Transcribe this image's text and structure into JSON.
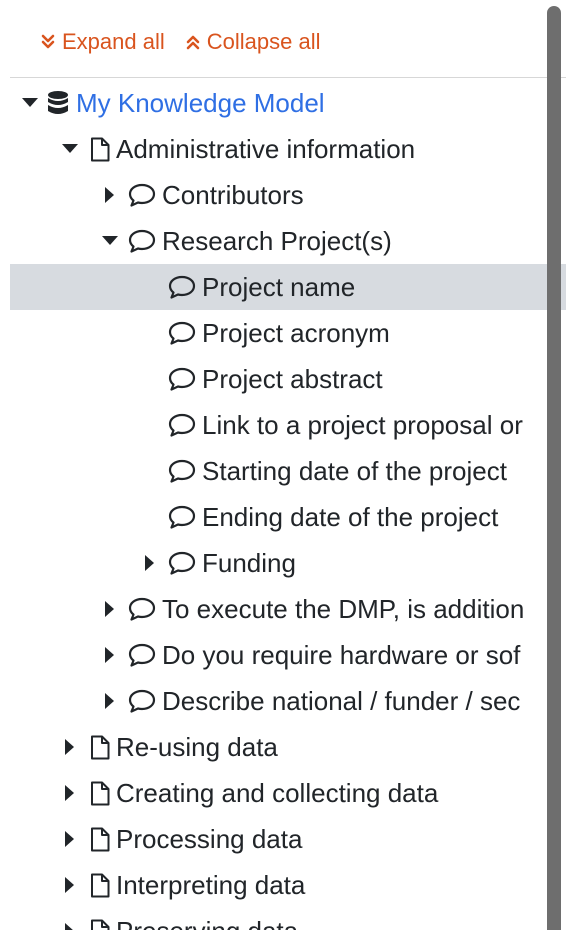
{
  "toolbar": {
    "expand_all": "Expand all",
    "collapse_all": "Collapse all",
    "accent_color": "#d9541e"
  },
  "tree": {
    "root": {
      "label": "My Knowledge Model",
      "icon": "database-icon",
      "color": "#2f6fe4",
      "expanded": true
    },
    "items": [
      {
        "label": "Administrative information",
        "icon": "file-icon",
        "level": 1,
        "caret": "down"
      },
      {
        "label": "Contributors",
        "icon": "comment-icon",
        "level": 2,
        "caret": "right"
      },
      {
        "label": "Research Project(s)",
        "icon": "comment-icon",
        "level": 2,
        "caret": "down"
      },
      {
        "label": "Project name",
        "icon": "comment-icon",
        "level": 3,
        "caret": "none",
        "selected": true
      },
      {
        "label": "Project acronym",
        "icon": "comment-icon",
        "level": 3,
        "caret": "none"
      },
      {
        "label": "Project abstract",
        "icon": "comment-icon",
        "level": 3,
        "caret": "none"
      },
      {
        "label": "Link to a project proposal or",
        "icon": "comment-icon",
        "level": 3,
        "caret": "none"
      },
      {
        "label": "Starting date of the project",
        "icon": "comment-icon",
        "level": 3,
        "caret": "none"
      },
      {
        "label": "Ending date of the project",
        "icon": "comment-icon",
        "level": 3,
        "caret": "none"
      },
      {
        "label": "Funding",
        "icon": "comment-icon",
        "level": 3,
        "caret": "right"
      },
      {
        "label": "To execute the DMP, is addition",
        "icon": "comment-icon",
        "level": 2,
        "caret": "right"
      },
      {
        "label": "Do you require hardware or sof",
        "icon": "comment-icon",
        "level": 2,
        "caret": "right"
      },
      {
        "label": "Describe national / funder / sec",
        "icon": "comment-icon",
        "level": 2,
        "caret": "right"
      },
      {
        "label": "Re-using data",
        "icon": "file-icon",
        "level": 1,
        "caret": "right"
      },
      {
        "label": "Creating and collecting data",
        "icon": "file-icon",
        "level": 1,
        "caret": "right"
      },
      {
        "label": "Processing data",
        "icon": "file-icon",
        "level": 1,
        "caret": "right"
      },
      {
        "label": "Interpreting data",
        "icon": "file-icon",
        "level": 1,
        "caret": "right"
      },
      {
        "label": "Preserving data",
        "icon": "file-icon",
        "level": 1,
        "caret": "right"
      }
    ]
  }
}
